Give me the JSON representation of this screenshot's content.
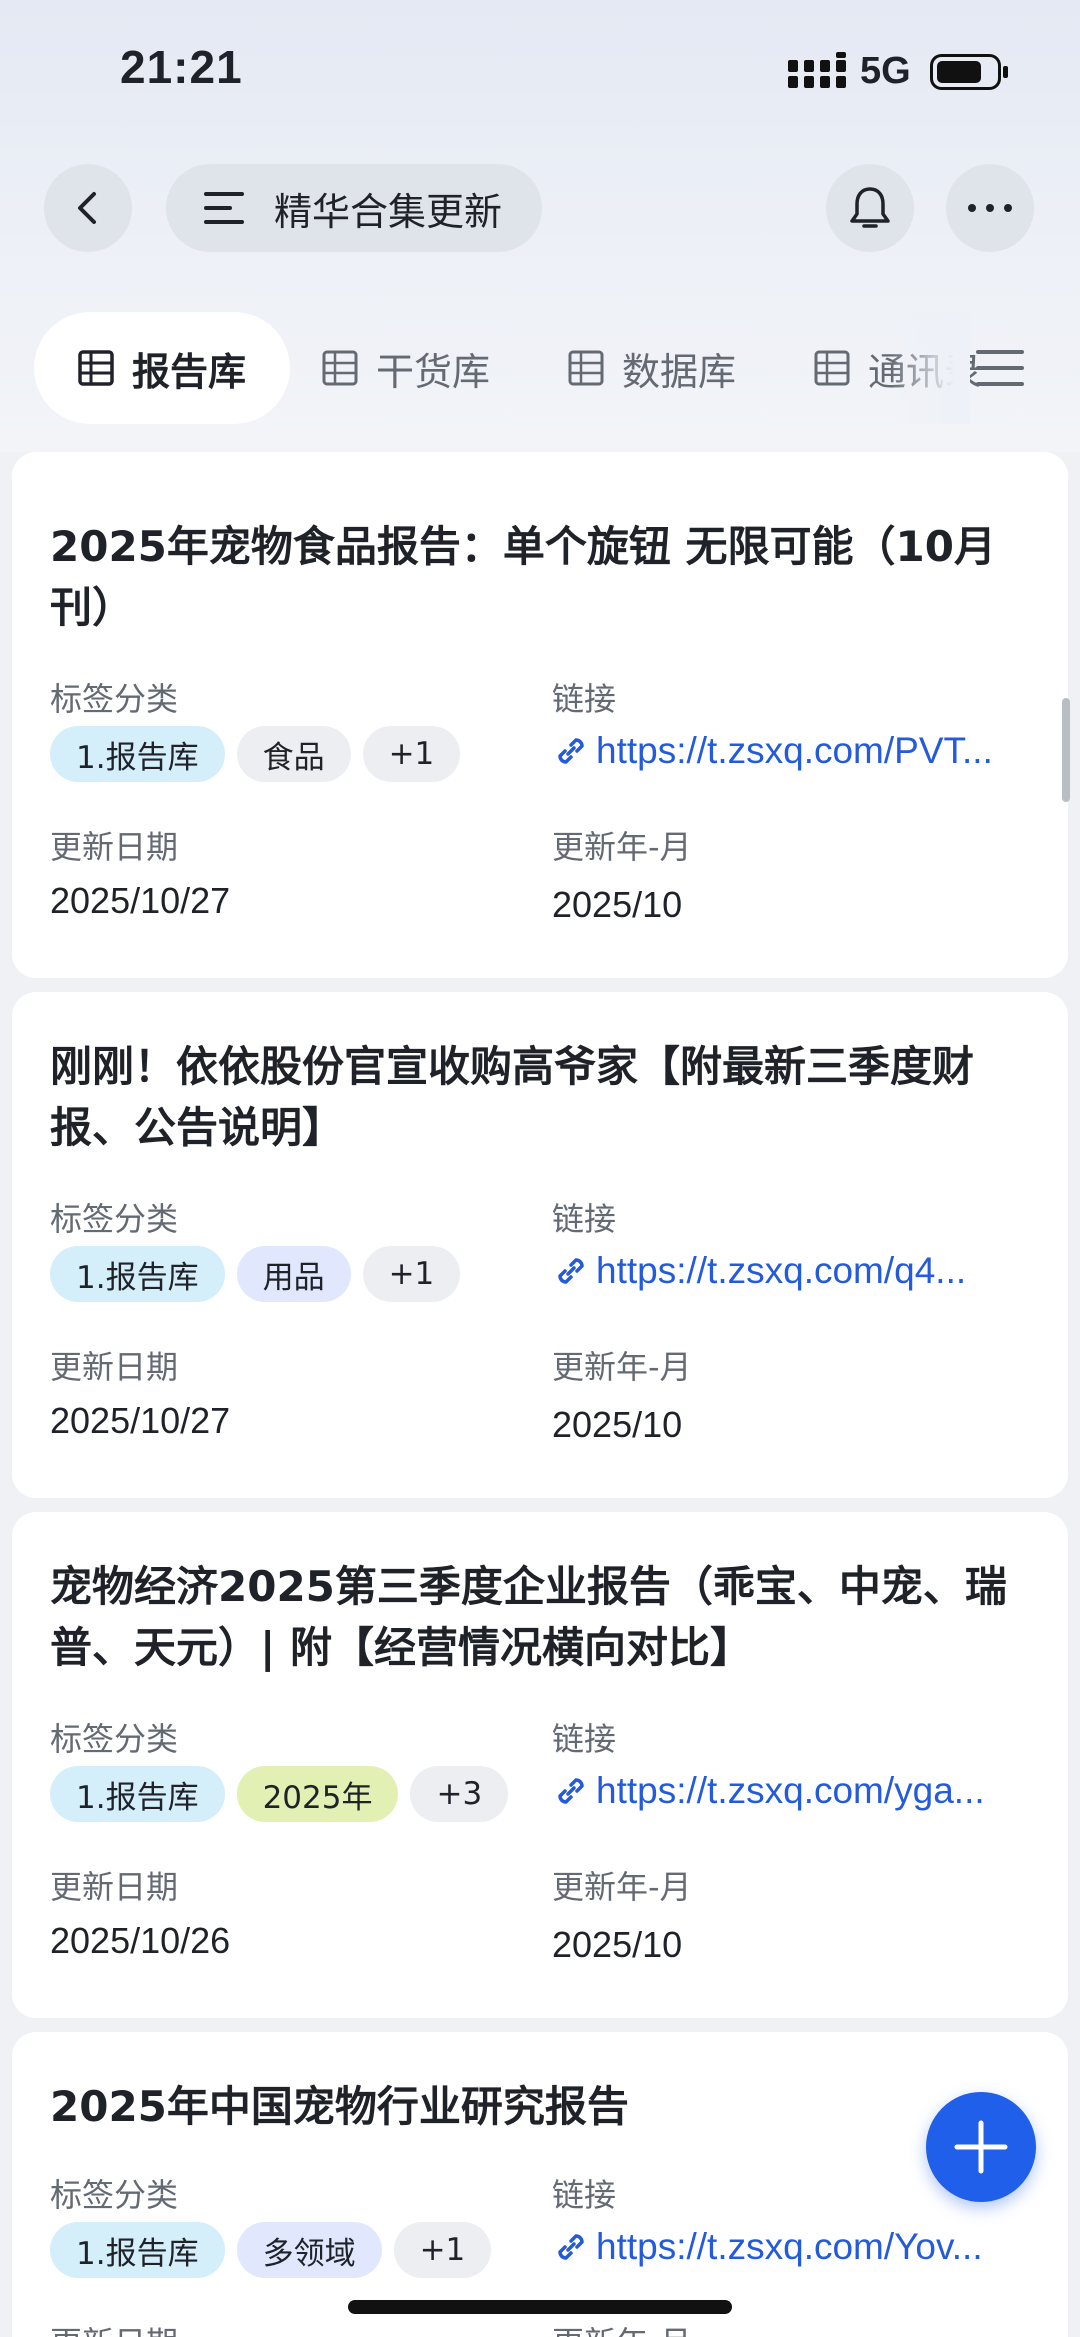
{
  "status_bar": {
    "time": "21:21",
    "network": "5G"
  },
  "nav": {
    "back_icon": "chevron-left-icon",
    "title": "精华合集更新",
    "bell_icon": "bell-icon",
    "more_icon": "more-dots-icon"
  },
  "tabs": [
    {
      "label": "报告库",
      "active": true
    },
    {
      "label": "干货库",
      "active": false
    },
    {
      "label": "数据库",
      "active": false
    },
    {
      "label": "通讯录",
      "active": false
    }
  ],
  "field_labels": {
    "tags": "标签分类",
    "link": "链接",
    "update_date": "更新日期",
    "update_month": "更新年-月"
  },
  "records": [
    {
      "title": "2025年宠物食品报告：单个旋钮 无限可能（10月刊）",
      "tags": [
        "1.报告库",
        "食品",
        "+1"
      ],
      "link": "https://t.zsxq.com/PVT...",
      "update_date": "2025/10/27",
      "update_month": "2025/10"
    },
    {
      "title": "刚刚！依依股份官宣收购高爷家【附最新三季度财报、公告说明】",
      "tags": [
        "1.报告库",
        "用品",
        "+1"
      ],
      "link": "https://t.zsxq.com/q4...",
      "update_date": "2025/10/27",
      "update_month": "2025/10"
    },
    {
      "title": "宠物经济2025第三季度企业报告（乖宝、中宠、瑞普、天元）| 附【经营情况横向对比】",
      "tags": [
        "1.报告库",
        "2025年",
        "+3"
      ],
      "link": "https://t.zsxq.com/yga...",
      "update_date": "2025/10/26",
      "update_month": "2025/10"
    },
    {
      "title": "2025年中国宠物行业研究报告",
      "tags": [
        "1.报告库",
        "多领域",
        "+1"
      ],
      "link": "https://t.zsxq.com/Yov...",
      "update_date": "",
      "update_month": ""
    }
  ],
  "fab_icon": "plus-icon",
  "colors": {
    "accent": "#245bdb",
    "fab": "#1f5fe9"
  }
}
